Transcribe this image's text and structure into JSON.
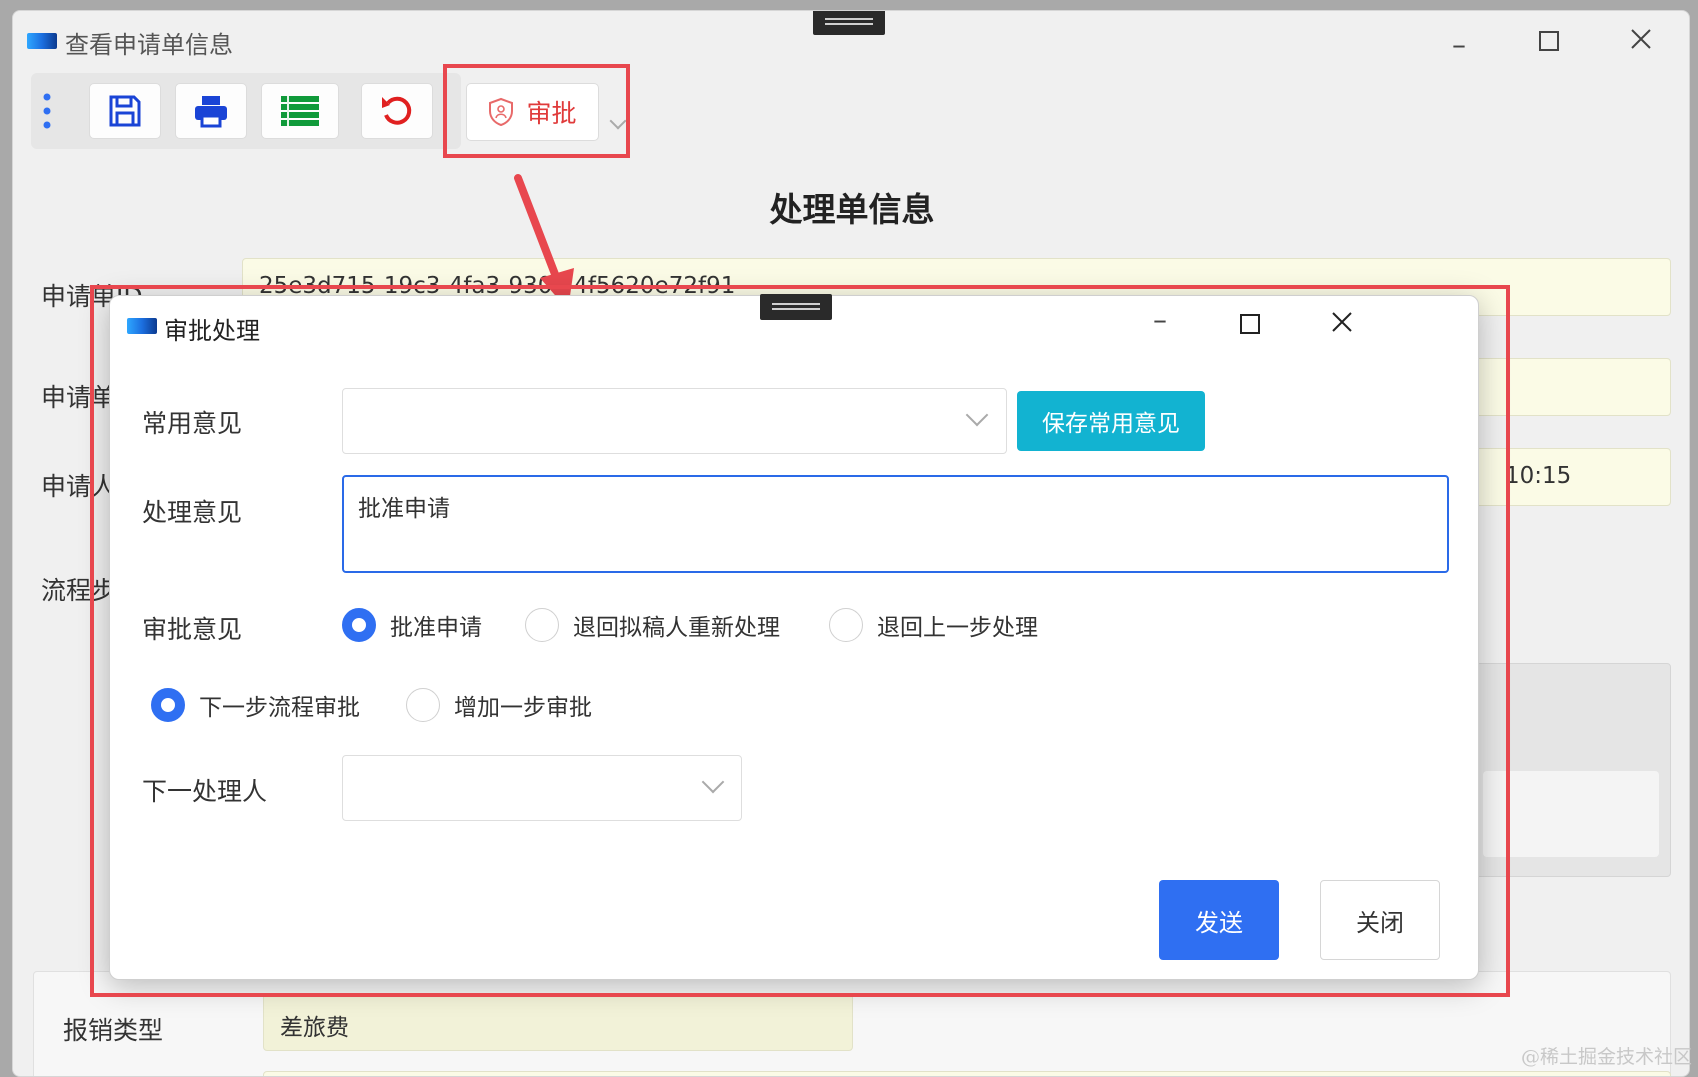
{
  "main_window": {
    "title": "查看申请单信息",
    "heading": "处理单信息",
    "fields": {
      "id_label": "申请单ID",
      "id_value": "25e3d715-19c3-4fa3-930c-4f5620e72f91",
      "row2_label": "申请单",
      "row3_label": "申请人",
      "row3_value_tail": "10:15",
      "flow_label": "流程步",
      "expense_type_label": "报销类型",
      "expense_type_value": "差旅费"
    }
  },
  "toolbar": {
    "buttons": [
      "save-icon",
      "print-icon",
      "list-icon",
      "refresh-icon"
    ],
    "approve_label": "审批"
  },
  "dialog": {
    "title": "审批处理",
    "common_opinion_label": "常用意见",
    "common_opinion_value": "",
    "save_common_label": "保存常用意见",
    "handling_opinion_label": "处理意见",
    "handling_opinion_value": "批准申请",
    "approval_opinion_label": "审批意见",
    "approval_options": [
      {
        "label": "批准申请",
        "selected": true
      },
      {
        "label": "退回拟稿人重新处理",
        "selected": false
      },
      {
        "label": "退回上一步处理",
        "selected": false
      }
    ],
    "step_options": [
      {
        "label": "下一步流程审批",
        "selected": true
      },
      {
        "label": "增加一步审批",
        "selected": false
      }
    ],
    "next_handler_label": "下一处理人",
    "next_handler_value": "",
    "send_label": "发送",
    "close_label": "关闭"
  },
  "colors": {
    "primary": "#2f6ff2",
    "cyan": "#12b3d1",
    "highlight_red": "#e8474e",
    "field_bg": "#fbfbe6"
  },
  "watermark": "@稀土掘金技术社区"
}
